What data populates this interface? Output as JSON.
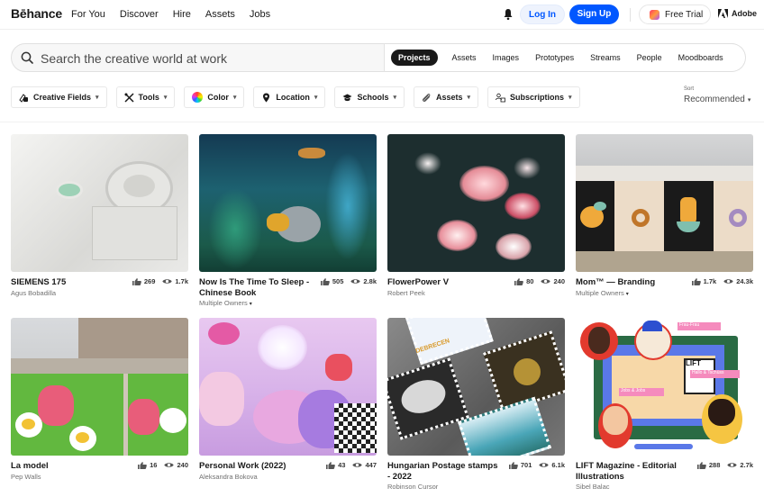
{
  "header": {
    "logo": "Bēhance",
    "nav": [
      "For You",
      "Discover",
      "Hire",
      "Assets",
      "Jobs"
    ],
    "login": "Log In",
    "signup": "Sign Up",
    "free_trial": "Free Trial",
    "adobe": "Adobe",
    "accent_color": "#0057ff"
  },
  "search": {
    "placeholder": "Search the creative world at work",
    "tabs": [
      "Projects",
      "Assets",
      "Images",
      "Prototypes",
      "Streams",
      "People",
      "Moodboards"
    ],
    "active_tab": "Projects"
  },
  "filters": [
    {
      "label": "Creative Fields",
      "icon": "creative-fields-icon"
    },
    {
      "label": "Tools",
      "icon": "tools-icon"
    },
    {
      "label": "Color",
      "icon": "color-wheel-icon"
    },
    {
      "label": "Location",
      "icon": "location-pin-icon"
    },
    {
      "label": "Schools",
      "icon": "graduation-cap-icon"
    },
    {
      "label": "Assets",
      "icon": "paperclip-icon"
    },
    {
      "label": "Subscriptions",
      "icon": "subscriptions-icon"
    }
  ],
  "sort": {
    "label": "Sort",
    "value": "Recommended"
  },
  "projects": [
    {
      "title": "SIEMENS 175",
      "owner": "Agus Bobadilla",
      "likes": "269",
      "views": "1.7k",
      "multi": false
    },
    {
      "title": "Now Is The Time To Sleep - Chinese Book",
      "owner": "Multiple Owners",
      "likes": "505",
      "views": "2.8k",
      "multi": true
    },
    {
      "title": "FlowerPower V",
      "owner": "Robert Peek",
      "likes": "80",
      "views": "240",
      "multi": false
    },
    {
      "title": "Mom™ — Branding",
      "owner": "Multiple Owners",
      "likes": "1.7k",
      "views": "24.3k",
      "multi": true
    },
    {
      "title": "La model",
      "owner": "Pep Walls",
      "likes": "16",
      "views": "240",
      "multi": false
    },
    {
      "title": "Personal Work (2022)",
      "owner": "Aleksandra Bokova",
      "likes": "43",
      "views": "447",
      "multi": false
    },
    {
      "title": "Hungarian Postage stamps - 2022",
      "owner": "Robinson Cursor",
      "likes": "701",
      "views": "6.1k",
      "multi": false
    },
    {
      "title": "LIFT Magazine - Editorial Illustrations",
      "owner": "Sibel Balac",
      "likes": "288",
      "views": "2.7k",
      "multi": false
    }
  ]
}
